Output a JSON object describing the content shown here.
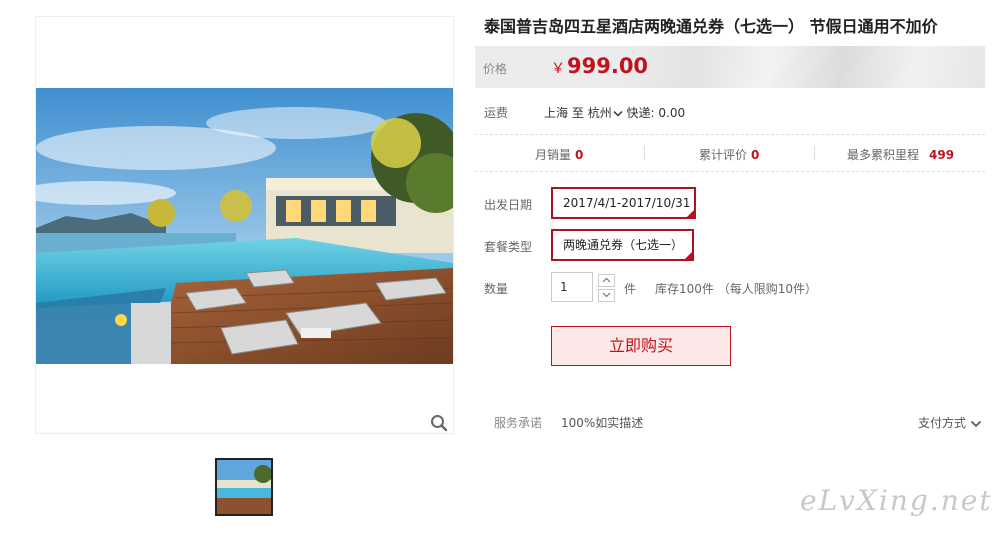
{
  "product": {
    "title": "泰国普吉岛四五星酒店两晚通兑券（七选一） 节假日通用不加价"
  },
  "price": {
    "label": "价格",
    "currency": "￥",
    "value": "999.00"
  },
  "shipping": {
    "label": "运费",
    "from": "上海",
    "to_word": "至",
    "to": "杭州",
    "express": "快递: 0.00"
  },
  "stats": {
    "monthly_sales_label": "月销量",
    "monthly_sales": "0",
    "reviews_label": "累计评价",
    "reviews": "0",
    "points_label": "最多累积里程",
    "points": "499"
  },
  "options": {
    "departure_label": "出发日期",
    "departure_value": "2017/4/1-2017/10/31",
    "package_label": "套餐类型",
    "package_value": "两晚通兑券（七选一）"
  },
  "quantity": {
    "label": "数量",
    "value": "1",
    "unit": "件",
    "stock_text": "库存100件 （每人限购10件）"
  },
  "buy_button": "立即购买",
  "service": {
    "label": "服务承诺",
    "value": "100%如实描述"
  },
  "payment_label": "支付方式",
  "watermark": "eLvXing.net",
  "colors": {
    "accent": "#c2121c",
    "button_bg": "#fde8e8",
    "price_band": "#ececec"
  },
  "icons": [
    "zoom-icon",
    "chevron-down-icon",
    "increment-icon",
    "decrement-icon"
  ]
}
